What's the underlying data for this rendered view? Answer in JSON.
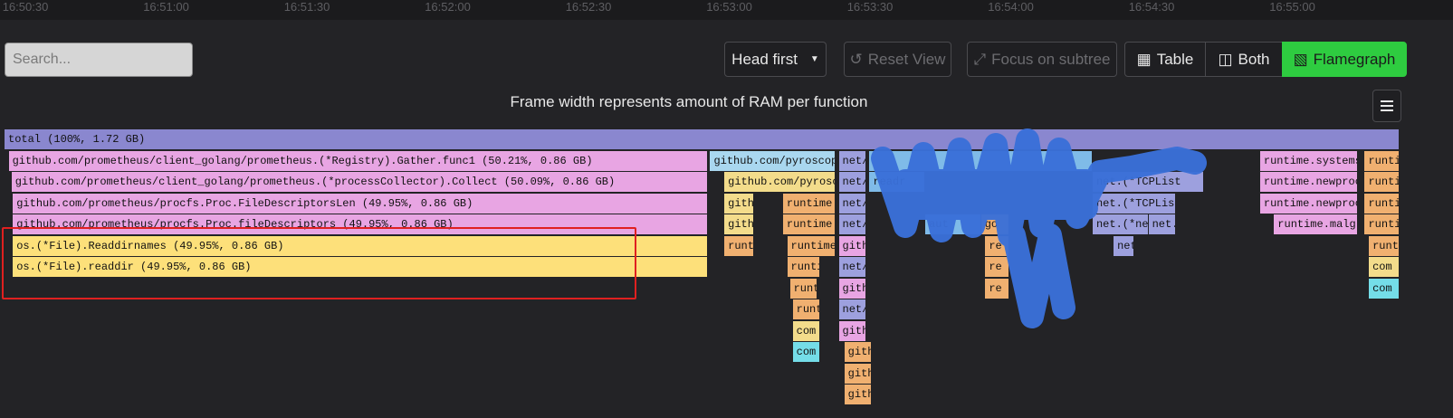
{
  "timeline": {
    "ticks": [
      "16:50:30",
      "16:51:00",
      "16:51:30",
      "16:52:00",
      "16:52:30",
      "16:53:00",
      "16:53:30",
      "16:54:00",
      "16:54:30",
      "16:55:00"
    ]
  },
  "toolbar": {
    "search_placeholder": "Search...",
    "view_mode_select": "Head first",
    "reset_view": "Reset View",
    "focus_subtree": "Focus on subtree",
    "table": "Table",
    "both": "Both",
    "flamegraph": "Flamegraph"
  },
  "flamegraph": {
    "title": "Frame width represents amount of RAM per function",
    "colors": {
      "accent": "#2ecc40",
      "selection": "#e02020",
      "annotation": "#3a6fd8"
    },
    "rows": [
      [
        {
          "label": "total (100%, 1.72 GB)",
          "color": "#8a87cf",
          "span": [
            0,
            1
          ]
        }
      ],
      [
        {
          "label": "github.com/prometheus/client_golang/prometheus.(*Registry).Gather.func1 (50.21%, 0.86 GB)",
          "color": "#e8a5e3",
          "span": [
            0.003,
            0.5044
          ]
        },
        {
          "label": "github.com/pyroscope",
          "color": "#a9d7ef",
          "span": [
            0.5058,
            0.596
          ]
        },
        {
          "label": "net/h",
          "color": "#9da0de",
          "span": [
            0.598,
            0.618
          ]
        },
        {
          "label": "",
          "color": "#7fbbe8",
          "span": [
            0.62,
            0.78
          ]
        },
        {
          "label": "runtime.systemst",
          "color": "#e8a5e3",
          "span": [
            0.9,
            0.97
          ]
        },
        {
          "label": "runti",
          "color": "#f0b070",
          "span": [
            0.975,
            1
          ]
        }
      ],
      [
        {
          "label": "github.com/prometheus/client_golang/prometheus.(*processCollector).Collect (50.09%, 0.86 GB)",
          "color": "#e8a5e3",
          "span": [
            0.005,
            0.5044
          ]
        },
        {
          "label": "github.com/pyrosco",
          "color": "#f3dc8b",
          "span": [
            0.516,
            0.596
          ]
        },
        {
          "label": "net/h",
          "color": "#9da0de",
          "span": [
            0.598,
            0.618
          ]
        },
        {
          "label": "readr",
          "color": "#7fbbe8",
          "span": [
            0.62,
            0.66
          ]
        },
        {
          "label": "net.(*TCPList",
          "color": "#9da0de",
          "span": [
            0.78,
            0.86
          ]
        },
        {
          "label": "runtime.newproc",
          "color": "#e8a5e3",
          "span": [
            0.9,
            0.97
          ]
        },
        {
          "label": "runti",
          "color": "#f0b070",
          "span": [
            0.975,
            1
          ]
        }
      ],
      [
        {
          "label": "github.com/prometheus/procfs.Proc.FileDescriptorsLen (49.95%, 0.86 GB)",
          "color": "#e8a5e3",
          "span": [
            0.006,
            0.5044
          ]
        },
        {
          "label": "githu",
          "color": "#f3dc8b",
          "span": [
            0.516,
            0.537
          ]
        },
        {
          "label": "runtime",
          "color": "#f0b070",
          "span": [
            0.558,
            0.596
          ]
        },
        {
          "label": "net/h",
          "color": "#9da0de",
          "span": [
            0.598,
            0.618
          ]
        },
        {
          "label": "net.(*TCPLis",
          "color": "#9da0de",
          "span": [
            0.78,
            0.84
          ]
        },
        {
          "label": "runtime.newproc",
          "color": "#e8a5e3",
          "span": [
            0.9,
            0.97
          ]
        },
        {
          "label": "runti",
          "color": "#f0b070",
          "span": [
            0.975,
            1
          ]
        }
      ],
      [
        {
          "label": "github.com/prometheus/procfs.Proc.fileDescriptors (49.95%, 0.86 GB)",
          "color": "#e8a5e3",
          "span": [
            0.006,
            0.5044
          ]
        },
        {
          "label": "githu",
          "color": "#f3dc8b",
          "span": [
            0.516,
            0.537
          ]
        },
        {
          "label": "runtime",
          "color": "#f0b070",
          "span": [
            0.558,
            0.596
          ]
        },
        {
          "label": "net/h",
          "color": "#9da0de",
          "span": [
            0.598,
            0.618
          ]
        },
        {
          "label": "aut",
          "color": "#7fbbe8",
          "span": [
            0.66,
            0.7
          ]
        },
        {
          "label": "go",
          "color": "#f0b070",
          "span": [
            0.7,
            0.72
          ]
        },
        {
          "label": "net.(*ne",
          "color": "#9da0de",
          "span": [
            0.78,
            0.82
          ]
        },
        {
          "label": "net.",
          "color": "#9da0de",
          "span": [
            0.82,
            0.84
          ]
        },
        {
          "label": "runtime.malg (",
          "color": "#e8a5e3",
          "span": [
            0.91,
            0.97
          ]
        },
        {
          "label": "runti",
          "color": "#f0b070",
          "span": [
            0.975,
            1
          ]
        }
      ],
      [
        {
          "label": "os.(*File).Readdirnames (49.95%, 0.86 GB)",
          "color": "#fde07a",
          "span": [
            0.006,
            0.5044
          ]
        },
        {
          "label": "runti",
          "color": "#f0b070",
          "span": [
            0.516,
            0.537
          ]
        },
        {
          "label": "runtime",
          "color": "#f0b070",
          "span": [
            0.561,
            0.596
          ]
        },
        {
          "label": "githu",
          "color": "#e8a5e3",
          "span": [
            0.598,
            0.618
          ]
        },
        {
          "label": "re",
          "color": "#f0b070",
          "span": [
            0.703,
            0.72
          ]
        },
        {
          "label": "net",
          "color": "#9da0de",
          "span": [
            0.795,
            0.81
          ]
        },
        {
          "label": "runti",
          "color": "#f0b070",
          "span": [
            0.978,
            1
          ]
        }
      ],
      [
        {
          "label": "os.(*File).readdir (49.95%, 0.86 GB)",
          "color": "#fde07a",
          "span": [
            0.006,
            0.5044
          ]
        },
        {
          "label": "runti",
          "color": "#f0b070",
          "span": [
            0.561,
            0.585
          ]
        },
        {
          "label": "net/h",
          "color": "#9da0de",
          "span": [
            0.598,
            0.618
          ]
        },
        {
          "label": "re",
          "color": "#f0b070",
          "span": [
            0.703,
            0.72
          ]
        },
        {
          "label": "com",
          "color": "#f3dc8b",
          "span": [
            0.978,
            1
          ]
        }
      ],
      [
        {
          "label": "runt",
          "color": "#f0b070",
          "span": [
            0.563,
            0.583
          ]
        },
        {
          "label": "githu",
          "color": "#e8a5e3",
          "span": [
            0.598,
            0.618
          ]
        },
        {
          "label": "re",
          "color": "#f0b070",
          "span": [
            0.703,
            0.72
          ]
        },
        {
          "label": "com",
          "color": "#74dde8",
          "span": [
            0.978,
            1
          ]
        }
      ],
      [
        {
          "label": "runt",
          "color": "#f0b070",
          "span": [
            0.565,
            0.585
          ]
        },
        {
          "label": "net/h",
          "color": "#9da0de",
          "span": [
            0.598,
            0.618
          ]
        }
      ],
      [
        {
          "label": "com",
          "color": "#f3dc8b",
          "span": [
            0.565,
            0.585
          ]
        },
        {
          "label": "githu",
          "color": "#e8a5e3",
          "span": [
            0.598,
            0.618
          ]
        }
      ],
      [
        {
          "label": "com",
          "color": "#74dde8",
          "span": [
            0.565,
            0.585
          ]
        },
        {
          "label": "gith",
          "color": "#f0b070",
          "span": [
            0.602,
            0.622
          ]
        }
      ],
      [
        {
          "label": "gith",
          "color": "#f0b070",
          "span": [
            0.602,
            0.622
          ]
        }
      ],
      [
        {
          "label": "gith",
          "color": "#f0b070",
          "span": [
            0.602,
            0.622
          ]
        }
      ]
    ]
  }
}
